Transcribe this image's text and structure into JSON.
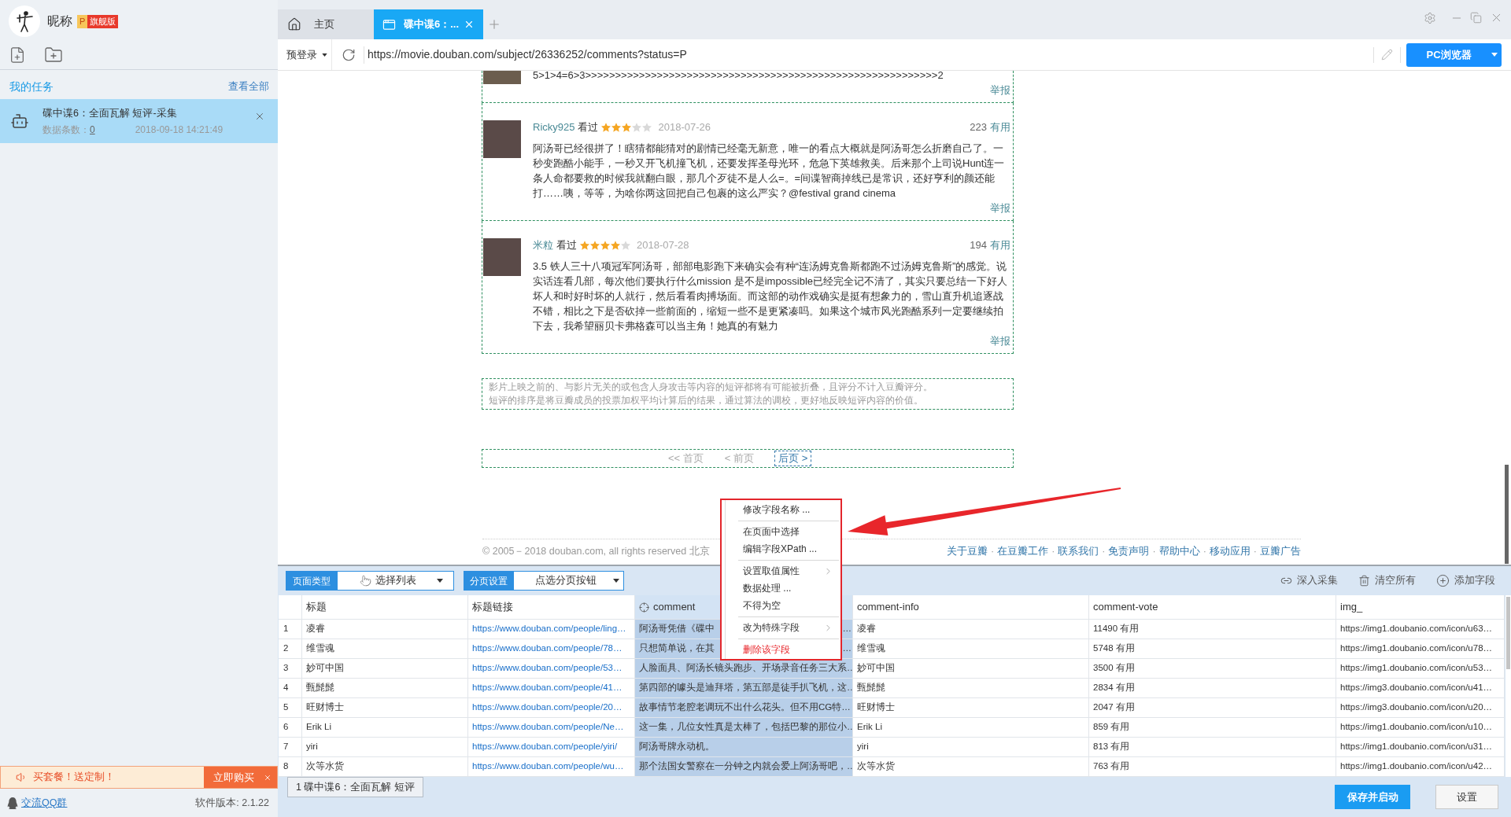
{
  "app": {
    "nickname": "昵称",
    "badge_letter": "P",
    "badge_label": "旗舰版"
  },
  "sidebar": {
    "section_title": "我的任务",
    "view_all": "查看全部",
    "tasks": [
      {
        "title": "碟中谍6：全面瓦解 短评-采集",
        "count_label": "数据条数：",
        "count": "0",
        "date": "2018-09-18 14:21:49",
        "selected": true
      }
    ],
    "promo": {
      "text": "买套餐！送定制！",
      "button": "立即购买"
    },
    "qq_group": "交流QQ群",
    "version": "软件版本: 2.1.22"
  },
  "tabs": [
    {
      "kind": "home",
      "label": "主页",
      "selected": false
    },
    {
      "kind": "page",
      "label": "碟中谍6：...",
      "selected": true
    }
  ],
  "address_bar": {
    "login_menu": "预登录",
    "url": "https://movie.douban.com/subject/26336252/comments?status=P",
    "browser_button": "PC浏览器"
  },
  "page": {
    "cut_comment": {
      "text": "5>1>4=6>3>>>>>>>>>>>>>>>>>>>>>>>>>>>>>>>>>>>>>>>>>>>>>>>>>>>>>>>>>>>2",
      "report": "举报"
    },
    "comments": [
      {
        "user": "Ricky925",
        "status": "看过",
        "stars": 3,
        "date": "2018-07-26",
        "votes": "223",
        "vote_label": "有用",
        "text": "阿汤哥已经很拼了！瞎猜都能猜对的剧情已经毫无新意，唯一的看点大概就是阿汤哥怎么折磨自己了。一秒变跑酷小能手，一秒又开飞机撞飞机，还要发挥圣母光环，危急下英雄救美。后来那个上司说Hunt连一条人命都要救的时候我就翻白眼，那几个歹徒不是人么=。=间谍智商掉线已是常识，还好亨利的颜还能打……咦，等等，为啥你两这回把自己包裹的这么严实？@festival grand cinema",
        "report": "举报"
      },
      {
        "user": "米粒",
        "status": "看过",
        "stars": 4,
        "date": "2018-07-28",
        "votes": "194",
        "vote_label": "有用",
        "text": "3.5 铁人三十八项冠军阿汤哥，部部电影跑下来确实会有种“连汤姆克鲁斯都跑不过汤姆克鲁斯”的感觉。说实话连看几部，每次他们要执行什么mission 是不是impossible已经完全记不清了，其实只要总结一下好人坏人和时好时坏的人就行，然后看看肉搏场面。而这部的动作戏确实是挺有想象力的，雪山直升机追逐战不错，相比之下是否砍掉一些前面的，缩短一些不是更紧凑吗。如果这个城市风光跑酷系列一定要继续拍下去，我希望丽贝卡弗格森可以当主角！她真的有魅力",
        "report": "举报"
      }
    ],
    "notes": [
      "影片上映之前的、与影片无关的或包含人身攻击等内容的短评都将有可能被折叠，且评分不计入豆瓣评分。",
      "短评的排序是将豆瓣成员的投票加权平均计算后的结果，通过算法的调校，更好地反映短评内容的价值。"
    ],
    "pagination": [
      {
        "label": "<< 首页",
        "disabled": true,
        "selected": false
      },
      {
        "label": "< 前页",
        "disabled": true,
        "selected": false
      },
      {
        "label": "后页 >",
        "disabled": false,
        "selected": true
      }
    ],
    "copyright": "© 2005－2018 douban.com, all rights reserved 北京",
    "footer_separator": "·",
    "footer_links": [
      "关于豆瓣",
      "在豆瓣工作",
      "联系我们",
      "免责声明",
      "帮助中心",
      "移动应用",
      "豆瓣广告"
    ]
  },
  "context_menu": {
    "items": [
      {
        "kind": "item",
        "label": "修改字段名称 ..."
      },
      {
        "kind": "separator"
      },
      {
        "kind": "item",
        "label": "在页面中选择"
      },
      {
        "kind": "item",
        "label": "编辑字段XPath ..."
      },
      {
        "kind": "separator"
      },
      {
        "kind": "submenu",
        "label": "设置取值属性"
      },
      {
        "kind": "item",
        "label": "数据处理 ..."
      },
      {
        "kind": "item",
        "label": "不得为空"
      },
      {
        "kind": "separator"
      },
      {
        "kind": "submenu",
        "label": "改为特殊字段"
      },
      {
        "kind": "separator"
      },
      {
        "kind": "danger",
        "label": "删除该字段"
      }
    ]
  },
  "panel": {
    "page_type_label": "页面类型",
    "page_type_value": "选择列表",
    "paging_label": "分页设置",
    "paging_value": "点选分页按钮",
    "actions": [
      {
        "kind": "link",
        "label": "深入采集"
      },
      {
        "kind": "trash",
        "label": "清空所有"
      },
      {
        "kind": "add",
        "label": "添加字段"
      }
    ]
  },
  "table": {
    "columns": [
      {
        "label": "标题",
        "selected": false
      },
      {
        "label": "标题链接",
        "selected": false
      },
      {
        "label": "comment",
        "selected": true
      },
      {
        "label": "comment-info",
        "selected": false
      },
      {
        "label": "comment-vote",
        "selected": false
      },
      {
        "label": "img_",
        "selected": false
      }
    ],
    "rows": [
      {
        "index": "1",
        "cells": [
          "凌睿",
          "https://www.douban.com/people/ling…",
          "阿汤哥凭借《碟中",
          "凌睿",
          "11490 有用",
          "https://img1.doubanio.com/icon/u63…"
        ],
        "covered_tail": "…"
      },
      {
        "index": "2",
        "cells": [
          "维雪魂",
          "https://www.douban.com/people/78…",
          "只想简单说，在其",
          "维雪魂",
          "5748 有用",
          "https://img1.doubanio.com/icon/u78…"
        ],
        "covered_tail": "…"
      },
      {
        "index": "3",
        "cells": [
          "妙可中国",
          "https://www.douban.com/people/53…",
          "人脸面具、阿汤长镜头跑步、开场录音任务三大系…",
          "妙可中国",
          "3500 有用",
          "https://img1.doubanio.com/icon/u53…"
        ]
      },
      {
        "index": "4",
        "cells": [
          "甄髭髭",
          "https://www.douban.com/people/41…",
          "第四部的噱头是迪拜塔，第五部是徒手扒飞机，这…",
          "甄髭髭",
          "2834 有用",
          "https://img3.doubanio.com/icon/u41…"
        ]
      },
      {
        "index": "5",
        "cells": [
          "旺财博士",
          "https://www.douban.com/people/20…",
          "故事情节老腔老调玩不出什么花头。但不用CG特…",
          "旺财博士",
          "2047 有用",
          "https://img3.doubanio.com/icon/u20…"
        ]
      },
      {
        "index": "6",
        "cells": [
          "Erik Li",
          "https://www.douban.com/people/Ne…",
          "这一集，几位女性真是太棒了，包括巴黎的那位小…",
          "Erik Li",
          "859 有用",
          "https://img1.doubanio.com/icon/u10…"
        ]
      },
      {
        "index": "7",
        "cells": [
          "yiri",
          "https://www.douban.com/people/yiri/",
          "阿汤哥牌永动机。",
          "yiri",
          "813 有用",
          "https://img1.doubanio.com/icon/u31…"
        ]
      },
      {
        "index": "8",
        "cells": [
          "次等水货",
          "https://www.douban.com/people/wu…",
          "那个法国女警察在一分钟之内就会爱上阿汤哥吧，…",
          "次等水货",
          "763 有用",
          "https://img1.doubanio.com/icon/u42…"
        ]
      }
    ]
  },
  "bottom_tabs": [
    {
      "label": "1 碟中谍6：全面瓦解 短评",
      "selected": true
    }
  ],
  "buttons": [
    {
      "kind": "primary",
      "label": "保存并启动"
    },
    {
      "kind": "secondary",
      "label": "设置"
    }
  ]
}
